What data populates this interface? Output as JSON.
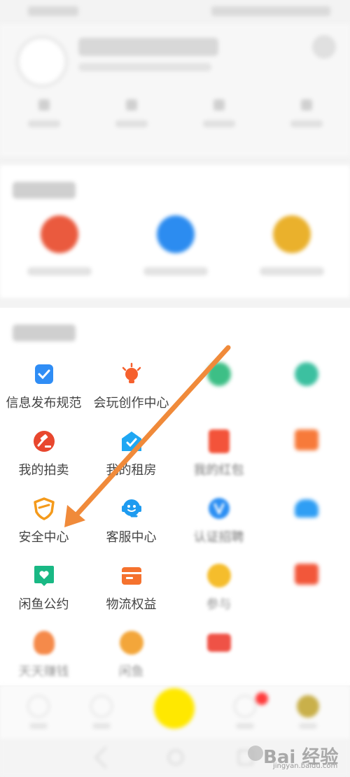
{
  "section_tools": {
    "rows": [
      [
        {
          "label": "信息发布规范",
          "icon": "publish-rules-icon",
          "color": "#2f8df5",
          "blurred": false
        },
        {
          "label": "会玩创作中心",
          "icon": "lightbulb-icon",
          "color": "#f6602d",
          "blurred": false
        },
        {
          "label": "",
          "icon": "green-icon",
          "color": "#3dbf86",
          "blurred": true
        },
        {
          "label": "",
          "icon": "teal-icon",
          "color": "#3cc0a0",
          "blurred": true
        }
      ],
      [
        {
          "label": "我的拍卖",
          "icon": "auction-hammer-icon",
          "color": "#e8472e",
          "blurred": false
        },
        {
          "label": "我的租房",
          "icon": "house-check-icon",
          "color": "#1fa7f3",
          "blurred": false
        },
        {
          "label": "我的红包",
          "icon": "red-packet-icon",
          "color": "#f3533a",
          "blurred": true
        },
        {
          "label": "",
          "icon": "orange-icon",
          "color": "#f77a3a",
          "blurred": true
        }
      ],
      [
        {
          "label": "安全中心",
          "icon": "shield-icon",
          "color": "#f49a1b",
          "blurred": false
        },
        {
          "label": "客服中心",
          "icon": "customer-service-icon",
          "color": "#1e9bf0",
          "blurred": false
        },
        {
          "label": "认证招聘",
          "icon": "verified-v-icon",
          "color": "#2c8ff3",
          "blurred": true
        },
        {
          "label": "",
          "icon": "blue-cloud-icon",
          "color": "#2f9ef4",
          "blurred": true
        }
      ],
      [
        {
          "label": "闲鱼公约",
          "icon": "heart-pact-icon",
          "color": "#19b884",
          "blurred": false
        },
        {
          "label": "物流权益",
          "icon": "logistics-box-icon",
          "color": "#f5722e",
          "blurred": false
        },
        {
          "label": "参与",
          "icon": "yellow-coin-icon",
          "color": "#f5bd2c",
          "blurred": true
        },
        {
          "label": "",
          "icon": "red-folder-icon",
          "color": "#f2573a",
          "blurred": true
        }
      ],
      [
        {
          "label": "天天赚钱",
          "icon": "money-bag-icon",
          "color": "#f58a4a",
          "blurred": true
        },
        {
          "label": "闲鱼",
          "icon": "eighty-family-icon",
          "color": "#f3a63a",
          "blurred": true
        },
        {
          "label": "",
          "icon": "video-icon",
          "color": "#ef5246",
          "blurred": true
        }
      ]
    ]
  },
  "section_services": {
    "items": [
      {
        "icon": "red-circle-icon",
        "color": "#ea5a3e"
      },
      {
        "icon": "blue-circle-icon",
        "color": "#2c8cf0"
      },
      {
        "icon": "yellow-circle-icon",
        "color": "#eab12c"
      }
    ]
  },
  "annotation": {
    "arrow_color": "#f08a3a"
  },
  "watermark": {
    "text": "Bai 经验",
    "url": "jingyan.baidu.com"
  }
}
